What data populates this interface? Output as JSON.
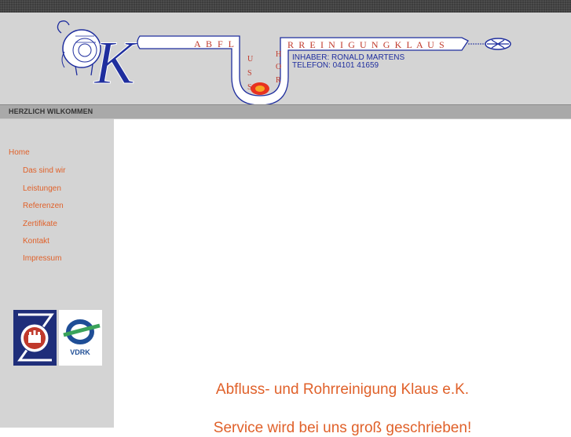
{
  "header": {
    "pipe_text_left": "A B F L",
    "pipe_text_down": [
      "U",
      "S",
      "S"
    ],
    "pipe_text_up": [
      "H",
      "O",
      "R"
    ],
    "pipe_text_right": "R R E I N I G U N G   K L A U S",
    "logo_letter": "K",
    "owner_line": "INHABER: RONALD MARTENS",
    "phone_line": "TELEFON: 04101 41659"
  },
  "navstrip": {
    "label": "HERZLICH WILKOMMEN"
  },
  "sidebar": {
    "items": [
      {
        "label": "Home"
      },
      {
        "label": "Das sind wir"
      },
      {
        "label": "Leistungen"
      },
      {
        "label": "Referenzen"
      },
      {
        "label": "Zertifikate"
      },
      {
        "label": "Kontakt"
      },
      {
        "label": "Impressum"
      }
    ],
    "badge_right_text": "VDRK"
  },
  "main": {
    "title": "Abfluss- und Rohrreinigung Klaus e.K.",
    "subtitle": "Service wird bei uns groß geschrieben!"
  },
  "colors": {
    "accent": "#e0612a",
    "pipe_text": "#c0392b",
    "brand_blue": "#1f2e9e",
    "panel_grey": "#d4d4d4"
  }
}
